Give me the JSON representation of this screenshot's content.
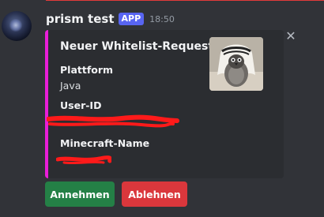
{
  "message": {
    "username": "prism test",
    "badge": "APP",
    "timestamp": "18:50"
  },
  "embed": {
    "accent_color": "#e91ed8",
    "title": "Neuer Whitelist-Request",
    "fields": [
      {
        "name": "Plattform",
        "value": "Java"
      },
      {
        "name": "User-ID",
        "value": ""
      },
      {
        "name": "Minecraft-Name",
        "value": ""
      }
    ],
    "thumbnail": "penguin-with-headscarf-image"
  },
  "close_icon": "close-icon",
  "buttons": {
    "accept_label": "Annehmen",
    "decline_label": "Ablehnen",
    "accept_color": "#248046",
    "decline_color": "#da373c"
  }
}
